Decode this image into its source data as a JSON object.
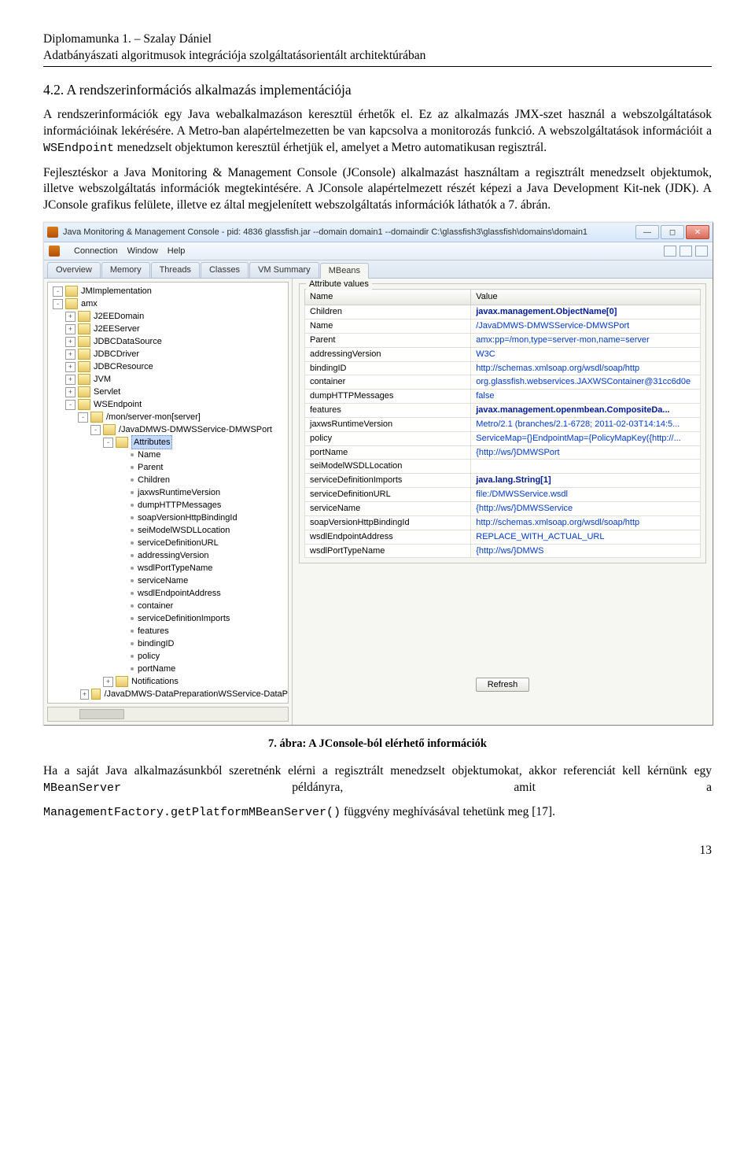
{
  "doc": {
    "header_line1": "Diplomamunka 1. – Szalay Dániel",
    "header_line2": "Adatbányászati algoritmusok integrációja szolgáltatásorientált architektúrában",
    "section_number": "4.2.",
    "section_title": "A rendszerinformációs alkalmazás implementációja",
    "p1_a": "A rendszerinformációk egy Java webalkalmazáson keresztül érhetők el. Ez az alkalmazás JMX-szet használ a webszolgáltatások információinak lekérésére. A Metro-ban alapértelmezetten be van kapcsolva a monitorozás funkció. A webszolgáltatások információit a ",
    "p1_code": "WSEndpoint",
    "p1_b": " menedzselt objektumon keresztül érhetjük el, amelyet a Metro automatikusan regisztrál.",
    "p2": "Fejlesztéskor a Java Monitoring & Management Console (JConsole) alkalmazást használtam a regisztrált menedzselt objektumok, illetve webszolgáltatás információk megtekintésére. A JConsole alapértelmezett részét képezi a Java Development Kit-nek (JDK). A JConsole grafikus felülete, illetve ez által megjelenített webszolgáltatás információk láthatók a 7. ábrán.",
    "caption": "7. ábra: A JConsole-ból elérhető információk",
    "p3_a": "Ha a saját Java alkalmazásunkból szeretnénk elérni a regisztrált menedzselt objektumokat, akkor referenciát kell kérnünk egy ",
    "p3_code1": "MBeanServer",
    "p3_b": " példányra, amit a ",
    "p3_code2": "ManagementFactory.getPlatformMBeanServer()",
    "p3_c": " függvény meghívásával tehetünk meg [17].",
    "page_number": "13"
  },
  "jconsole": {
    "title": "Java Monitoring & Management Console - pid: 4836 glassfish.jar --domain domain1 --domaindir C:\\glassfish3\\glassfish\\domains\\domain1",
    "menus": [
      "Connection",
      "Window",
      "Help"
    ],
    "tabs": [
      "Overview",
      "Memory",
      "Threads",
      "Classes",
      "VM Summary",
      "MBeans"
    ],
    "active_tab": "MBeans",
    "attr_panel_title": "Attribute values",
    "col_name": "Name",
    "col_value": "Value",
    "refresh_label": "Refresh",
    "tree": [
      {
        "d": 0,
        "e": "-",
        "t": "fld",
        "l": "JMImplementation"
      },
      {
        "d": 0,
        "e": "-",
        "t": "fld",
        "l": "amx"
      },
      {
        "d": 1,
        "e": "+",
        "t": "fld",
        "l": "J2EEDomain"
      },
      {
        "d": 1,
        "e": "+",
        "t": "fld",
        "l": "J2EEServer"
      },
      {
        "d": 1,
        "e": "+",
        "t": "fld",
        "l": "JDBCDataSource"
      },
      {
        "d": 1,
        "e": "+",
        "t": "fld",
        "l": "JDBCDriver"
      },
      {
        "d": 1,
        "e": "+",
        "t": "fld",
        "l": "JDBCResource"
      },
      {
        "d": 1,
        "e": "+",
        "t": "fld",
        "l": "JVM"
      },
      {
        "d": 1,
        "e": "+",
        "t": "fld",
        "l": "Servlet"
      },
      {
        "d": 1,
        "e": "-",
        "t": "fld",
        "l": "WSEndpoint"
      },
      {
        "d": 2,
        "e": "-",
        "t": "fld",
        "l": "/mon/server-mon[server]"
      },
      {
        "d": 3,
        "e": "-",
        "t": "fld",
        "l": "/JavaDMWS-DMWSService-DMWSPort"
      },
      {
        "d": 4,
        "e": "-",
        "t": "fld",
        "l": "Attributes",
        "sel": true
      },
      {
        "d": 5,
        "e": "",
        "t": "dot",
        "l": "Name"
      },
      {
        "d": 5,
        "e": "",
        "t": "dot",
        "l": "Parent"
      },
      {
        "d": 5,
        "e": "",
        "t": "dot",
        "l": "Children"
      },
      {
        "d": 5,
        "e": "",
        "t": "dot",
        "l": "jaxwsRuntimeVersion"
      },
      {
        "d": 5,
        "e": "",
        "t": "dot",
        "l": "dumpHTTPMessages"
      },
      {
        "d": 5,
        "e": "",
        "t": "dot",
        "l": "soapVersionHttpBindingId"
      },
      {
        "d": 5,
        "e": "",
        "t": "dot",
        "l": "seiModelWSDLLocation"
      },
      {
        "d": 5,
        "e": "",
        "t": "dot",
        "l": "serviceDefinitionURL"
      },
      {
        "d": 5,
        "e": "",
        "t": "dot",
        "l": "addressingVersion"
      },
      {
        "d": 5,
        "e": "",
        "t": "dot",
        "l": "wsdlPortTypeName"
      },
      {
        "d": 5,
        "e": "",
        "t": "dot",
        "l": "serviceName"
      },
      {
        "d": 5,
        "e": "",
        "t": "dot",
        "l": "wsdlEndpointAddress"
      },
      {
        "d": 5,
        "e": "",
        "t": "dot",
        "l": "container"
      },
      {
        "d": 5,
        "e": "",
        "t": "dot",
        "l": "serviceDefinitionImports"
      },
      {
        "d": 5,
        "e": "",
        "t": "dot",
        "l": "features"
      },
      {
        "d": 5,
        "e": "",
        "t": "dot",
        "l": "bindingID"
      },
      {
        "d": 5,
        "e": "",
        "t": "dot",
        "l": "policy"
      },
      {
        "d": 5,
        "e": "",
        "t": "dot",
        "l": "portName"
      },
      {
        "d": 4,
        "e": "+",
        "t": "fld",
        "l": "Notifications"
      },
      {
        "d": 3,
        "e": "+",
        "t": "fld",
        "l": "/JavaDMWS-DataPreparationWSService-DataP"
      }
    ],
    "attrs": [
      {
        "n": "Children",
        "v": "javax.management.ObjectName[0]",
        "b": true
      },
      {
        "n": "Name",
        "v": "/JavaDMWS-DMWSService-DMWSPort",
        "b": false
      },
      {
        "n": "Parent",
        "v": "amx:pp=/mon,type=server-mon,name=server",
        "b": false
      },
      {
        "n": "addressingVersion",
        "v": "W3C",
        "b": false
      },
      {
        "n": "bindingID",
        "v": "http://schemas.xmlsoap.org/wsdl/soap/http",
        "b": false
      },
      {
        "n": "container",
        "v": "org.glassfish.webservices.JAXWSContainer@31cc6d0e",
        "b": false
      },
      {
        "n": "dumpHTTPMessages",
        "v": "false",
        "b": false
      },
      {
        "n": "features",
        "v": "javax.management.openmbean.CompositeDa...",
        "b": true
      },
      {
        "n": "jaxwsRuntimeVersion",
        "v": "Metro/2.1 (branches/2.1-6728; 2011-02-03T14:14:5...",
        "b": false
      },
      {
        "n": "policy",
        "v": "ServiceMap={}EndpointMap={PolicyMapKey({http://...",
        "b": false
      },
      {
        "n": "portName",
        "v": "{http://ws/}DMWSPort",
        "b": false
      },
      {
        "n": "seiModelWSDLLocation",
        "v": "",
        "b": false
      },
      {
        "n": "serviceDefinitionImports",
        "v": "java.lang.String[1]",
        "b": true
      },
      {
        "n": "serviceDefinitionURL",
        "v": "file:/DMWSService.wsdl",
        "b": false
      },
      {
        "n": "serviceName",
        "v": "{http://ws/}DMWSService",
        "b": false
      },
      {
        "n": "soapVersionHttpBindingId",
        "v": "http://schemas.xmlsoap.org/wsdl/soap/http",
        "b": false
      },
      {
        "n": "wsdlEndpointAddress",
        "v": "REPLACE_WITH_ACTUAL_URL",
        "b": false
      },
      {
        "n": "wsdlPortTypeName",
        "v": "{http://ws/}DMWS",
        "b": false
      }
    ]
  }
}
